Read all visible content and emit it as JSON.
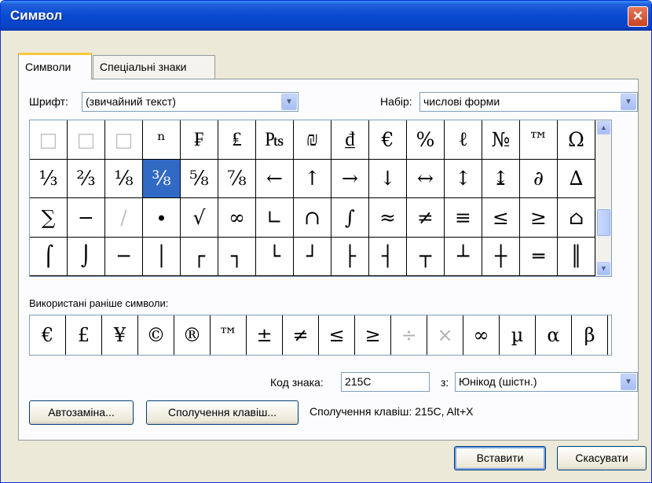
{
  "window": {
    "title": "Символ",
    "close_glyph": "✕"
  },
  "tabs": [
    {
      "label": "Символи",
      "active": true
    },
    {
      "label": "Спеціальні знаки",
      "active": false
    }
  ],
  "font": {
    "label": "Шрифт:",
    "value": "(звичайний текст)"
  },
  "subset": {
    "label": "Набір:",
    "value": "числові форми"
  },
  "symbol_grid": {
    "selected": "⅜",
    "rows": [
      [
        "□",
        "□",
        "□",
        "ⁿ",
        "₣",
        "₤",
        "₧",
        "₪",
        "₫",
        "€",
        "%",
        "ℓ",
        "№",
        "™",
        "Ω",
        "℮"
      ],
      [
        "⅓",
        "⅔",
        "⅛",
        "⅜",
        "⅝",
        "⅞",
        "←",
        "↑",
        "→",
        "↓",
        "↔",
        "↕",
        "↨",
        "∂",
        "∆",
        "∏"
      ],
      [
        "∑",
        "−",
        "∕",
        "∙",
        "√",
        "∞",
        "∟",
        "∩",
        "∫",
        "≈",
        "≠",
        "≡",
        "≤",
        "≥",
        "⌂",
        "⌐"
      ],
      [
        "⌠",
        "⌡",
        "─",
        "│",
        "┌",
        "┐",
        "└",
        "┘",
        "├",
        "┤",
        "┬",
        "┴",
        "┼",
        "═",
        "║",
        "╒"
      ]
    ]
  },
  "recent": {
    "label": "Використані раніше символи:",
    "symbols": [
      "€",
      "£",
      "¥",
      "©",
      "®",
      "™",
      "±",
      "≠",
      "≤",
      "≥",
      "÷",
      "×",
      "∞",
      "µ",
      "α",
      "β"
    ]
  },
  "char_code": {
    "label": "Код знака:",
    "value": "215C"
  },
  "from": {
    "label": "з:",
    "value": "Юнікод (шістн.)"
  },
  "buttons": {
    "autocorrect": "Автозаміна...",
    "shortcut_key": "Сполучення клавіш...",
    "insert": "Вставити",
    "cancel": "Скасувати"
  },
  "shortcut_info": "Сполучення клавіш: 215C, Alt+X"
}
